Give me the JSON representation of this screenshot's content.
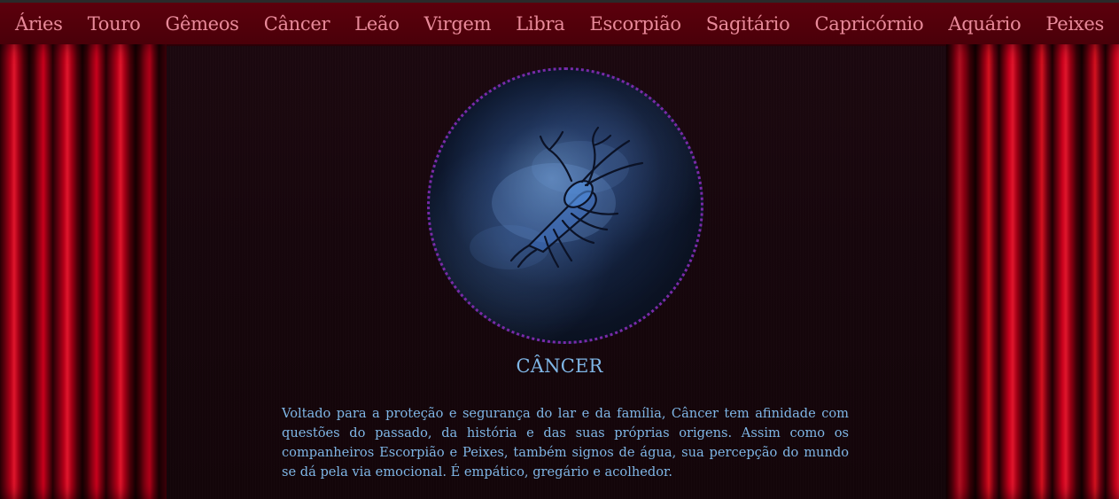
{
  "nav": {
    "items": [
      {
        "label": "Áries"
      },
      {
        "label": "Touro"
      },
      {
        "label": "Gêmeos"
      },
      {
        "label": "Câncer"
      },
      {
        "label": "Leão"
      },
      {
        "label": "Virgem"
      },
      {
        "label": "Libra"
      },
      {
        "label": "Escorpião"
      },
      {
        "label": "Sagitário"
      },
      {
        "label": "Capricórnio"
      },
      {
        "label": "Aquário"
      },
      {
        "label": "Peixes"
      }
    ]
  },
  "sign": {
    "title": "CÂNCER",
    "image_icon": "crab-constellation-icon",
    "description": "Voltado para a proteção e segurança do lar e da família, Câncer tem afinidade com questões do passado, da história e das suas próprias origens. Assim como os companheiros Escorpião e Peixes, também signos de água, sua percepção do mundo se dá pela via emocional. É empático, gregário e acolhedor."
  },
  "colors": {
    "nav_bg": "#4a0009",
    "nav_text": "#e88a9a",
    "page_bg": "#16060c",
    "text_accent": "#7fb6e6",
    "image_border": "#7a2aa8",
    "curtain_red": "#c8001c"
  }
}
